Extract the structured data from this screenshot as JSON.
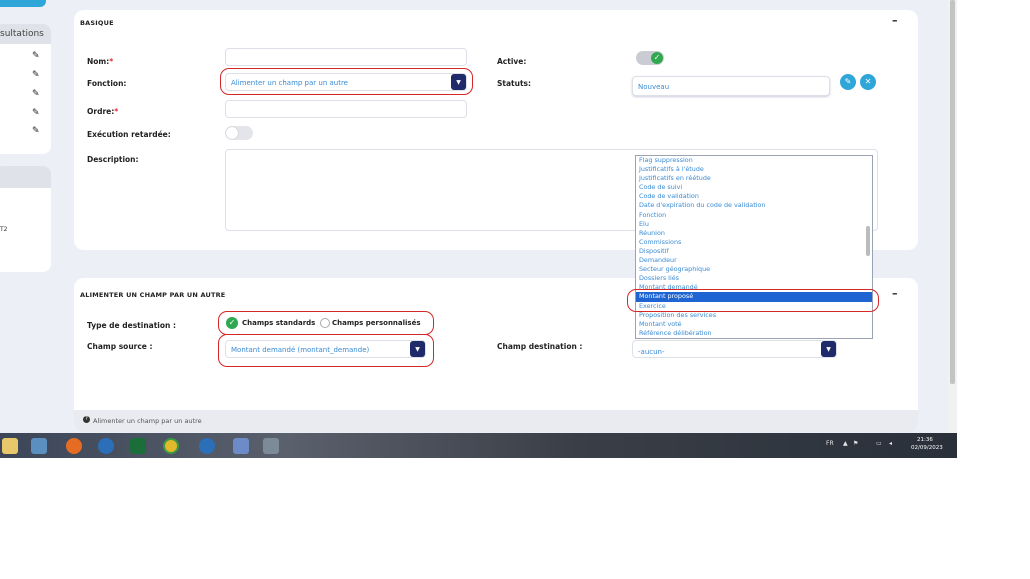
{
  "sidebar": {
    "consultations_label": "sultations",
    "text_fragment": "T2"
  },
  "basique": {
    "title": "BASIQUE",
    "collapse": "–",
    "nom_label": "Nom:",
    "required_mark": "*",
    "fonction_label": "Fonction:",
    "fonction_value": "Alimenter un champ par un autre",
    "ordre_label": "Ordre:",
    "execution_label": "Exécution retardée:",
    "description_label": "Description:",
    "active_label": "Active:",
    "statuts_label": "Statuts:",
    "statuts_value": "Nouveau"
  },
  "dropdown": {
    "options": [
      "Flag suppression",
      "Justificatifs à l'étude",
      "Justificatifs en réétude",
      "Code de suivi",
      "Code de validation",
      "Date d'expiration du code de validation",
      "Fonction",
      "Elu",
      "Réunion",
      "Commissions",
      "Dispositif",
      "Demandeur",
      "Secteur géographique",
      "Dossiers liés",
      "Montant demandé",
      "Montant proposé",
      "Exercice",
      "Proposition des services",
      "Montant voté",
      "Référence délibération"
    ],
    "selected": "Montant proposé"
  },
  "alimenter": {
    "title": "ALIMENTER UN CHAMP PAR UN AUTRE",
    "collapse": "–",
    "type_label": "Type de destination :",
    "radio_standard": "Champs standards",
    "radio_custom": "Champs personnalisés",
    "source_label": "Champ source :",
    "source_value": "Montant demandé (montant_demande)",
    "dest_label": "Champ destination :",
    "dest_value": "-aucun-",
    "footer_info": "Alimenter un champ par un autre"
  },
  "taskbar": {
    "lang": "FR",
    "time": "21:36",
    "date": "02/09/2023"
  },
  "colors": {
    "accent_navy": "#1f2a6b",
    "toggle_green": "#2fa84f",
    "link_blue": "#3a8bd4",
    "highlight_red": "#d52727",
    "selection_blue": "#1e64d2",
    "teal": "#2fa6d8"
  }
}
